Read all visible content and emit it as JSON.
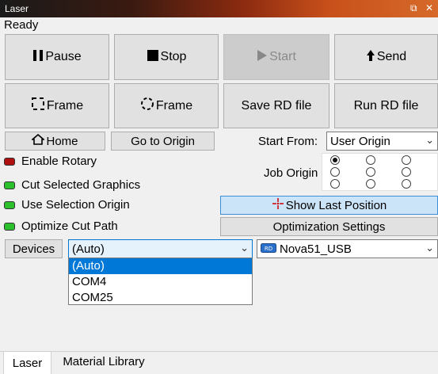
{
  "window": {
    "title": "Laser",
    "restore_icon": "restore-icon",
    "close_icon": "close-icon"
  },
  "status": "Ready",
  "buttons": {
    "pause": "Pause",
    "stop": "Stop",
    "start": "Start",
    "send": "Send",
    "frame_rect": "Frame",
    "frame_circle": "Frame",
    "save_rd": "Save RD file",
    "run_rd": "Run RD file",
    "home": "Home",
    "go_origin": "Go to Origin",
    "show_last_position": "Show Last Position",
    "optimization_settings": "Optimization Settings",
    "devices": "Devices"
  },
  "start_from": {
    "label": "Start From:",
    "value": "User Origin"
  },
  "job_origin": {
    "label": "Job Origin",
    "selected_index": 0
  },
  "options": [
    {
      "label": "Enable Rotary",
      "state": "off",
      "color": "#b01010"
    },
    {
      "label": "Cut Selected Graphics",
      "state": "on",
      "color": "#2cc02c"
    },
    {
      "label": "Use Selection Origin",
      "state": "on",
      "color": "#2cc02c"
    },
    {
      "label": "Optimize Cut Path",
      "state": "on",
      "color": "#2cc02c"
    }
  ],
  "port": {
    "value": "(Auto)",
    "options": [
      "(Auto)",
      "COM4",
      "COM25"
    ]
  },
  "device": {
    "value": "Nova51_USB",
    "icon": "rd-controller-icon"
  },
  "tabs": [
    "Laser",
    "Material Library"
  ]
}
